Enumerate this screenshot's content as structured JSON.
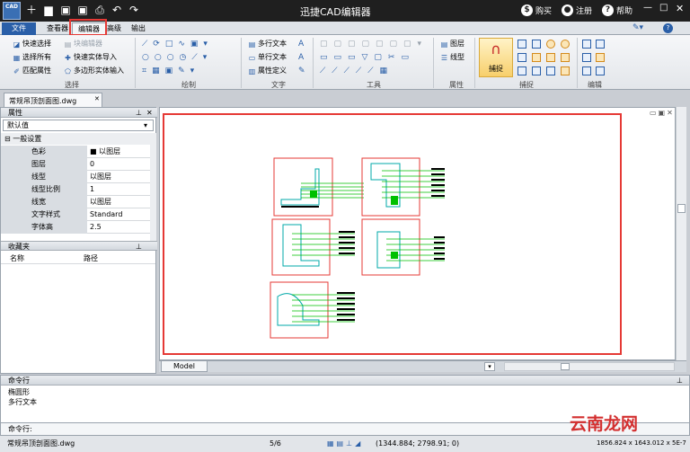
{
  "app": {
    "logo": "CAD",
    "title": "迅捷CAD编辑器"
  },
  "title_right": {
    "buy": "购买",
    "register": "注册",
    "help": "帮助"
  },
  "tabs": [
    "文件",
    "查看器",
    "编辑器",
    "高级",
    "输出"
  ],
  "ribbon": {
    "select": {
      "items": [
        "快速选择",
        "选择所有",
        "匹配属性"
      ],
      "items2": [
        "块编辑器",
        "快速实体导入",
        "多边形实体输入"
      ],
      "label": "选择"
    },
    "draw": {
      "label": "绘制"
    },
    "text": {
      "items": [
        "多行文本",
        "单行文本",
        "属性定义"
      ],
      "label": "文字"
    },
    "tools": {
      "label": "工具"
    },
    "props": {
      "items": [
        "图层",
        "线型"
      ],
      "label": "属性"
    },
    "snap": {
      "big": "捕捉",
      "label": "捕捉"
    },
    "edit": {
      "label": "编辑"
    }
  },
  "doc_tab": "常规吊顶剖面图.dwg",
  "properties": {
    "header": "属性",
    "combo": "默认值",
    "group": "一般设置",
    "rows": [
      {
        "k": "色彩",
        "v": "■ 以图层"
      },
      {
        "k": "图层",
        "v": "0"
      },
      {
        "k": "线型",
        "v": "以图层"
      },
      {
        "k": "线型比例",
        "v": "1"
      },
      {
        "k": "线宽",
        "v": "以图层"
      },
      {
        "k": "文字样式",
        "v": "Standard"
      },
      {
        "k": "字体高",
        "v": "2.5"
      }
    ]
  },
  "favorites": {
    "header": "收藏夹",
    "col1": "名称",
    "col2": "路径"
  },
  "model_tab": "Model",
  "command": {
    "header": "命令行",
    "lines": [
      "椭圆形",
      "多行文本"
    ],
    "prompt": "命令行:"
  },
  "status": {
    "file": "常规吊顶剖面图.dwg",
    "page": "5/6",
    "coords": "(1344.884; 2798.91; 0)",
    "extents": "1856.824 x 1643.012 x 5E-7"
  },
  "watermark": "云南龙网",
  "colors": {
    "accent": "#2a5fa8",
    "highlight": "#e53935",
    "cad_green": "#00c000",
    "cad_cyan": "#00a8a8"
  }
}
